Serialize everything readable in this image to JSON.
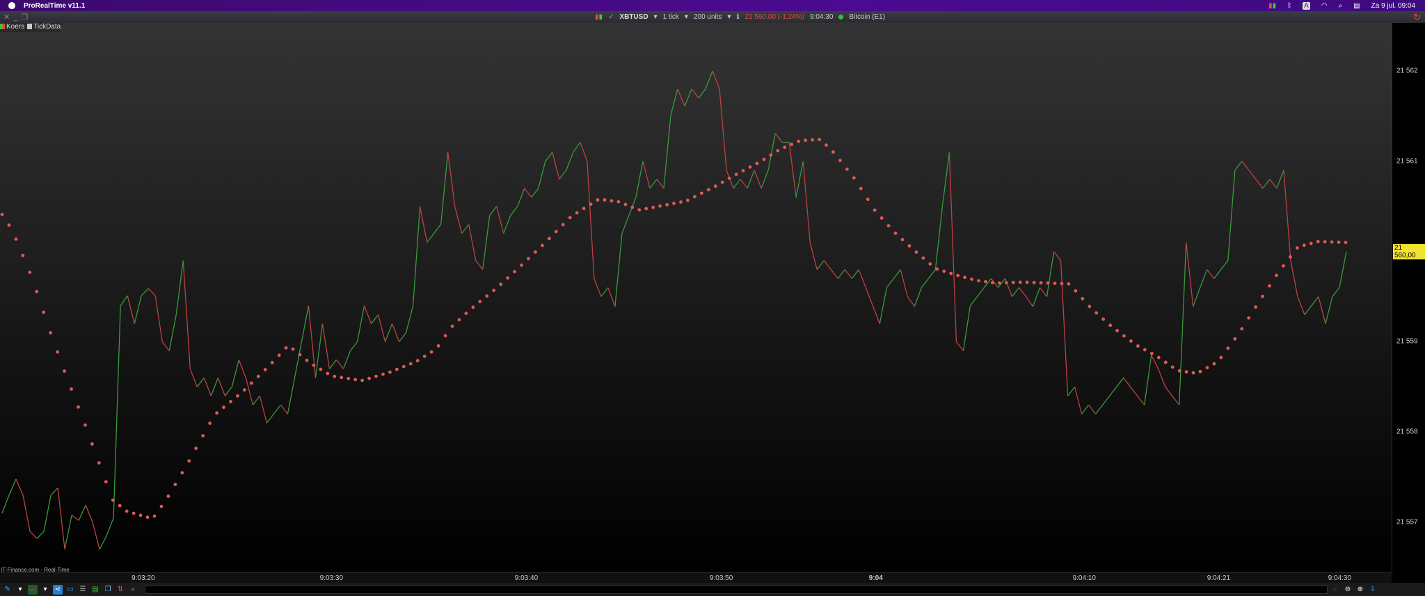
{
  "menubar": {
    "app_name": "ProRealTime v11.1",
    "date_time": "Za 9 jul.  09:04",
    "keyboard": "A"
  },
  "window": {
    "close": "✕",
    "minimize": "_",
    "restore": "❐"
  },
  "symbol_bar": {
    "symbol": "XBTUSD",
    "interval": "1 tick",
    "units": "200 units",
    "price": "21 560,00 (-1,24%)",
    "time": "9:04:30",
    "instrument": "Bitcoin (E1)"
  },
  "legend": {
    "items": [
      {
        "label": "Koers",
        "color": "#e04040"
      },
      {
        "label": "TickData",
        "color": "#cccccc"
      }
    ]
  },
  "source": "IT-Finance.com - Real-Time",
  "colors": {
    "up": "#3a9a3a",
    "down": "#c04040",
    "dots": "#e05a55",
    "current": "#f2e230"
  },
  "chart_data": {
    "type": "line",
    "title": "XBTUSD 1 tick",
    "y_ticks": [
      "21 562",
      "21 561",
      "21 560,00",
      "21 559",
      "21 558",
      "21 557"
    ],
    "y_tick_values": [
      21562,
      21561,
      21560,
      21559,
      21558,
      21557
    ],
    "ylim": [
      21556.5,
      21562.55
    ],
    "current_price": "21 560,00",
    "x_ticks": [
      "9:03:20",
      "9:03:30",
      "9:03:40",
      "9:03:50",
      "9:04",
      "9:04:10",
      "9:04:21",
      "9:04:30"
    ],
    "x_tick_index": [
      21,
      49,
      78,
      107,
      130,
      161,
      181,
      199
    ],
    "x_range": [
      0,
      200
    ],
    "price": [
      21557.1,
      21557.3,
      21557.48,
      21557.3,
      21556.9,
      21556.82,
      21556.9,
      21557.3,
      21557.38,
      21556.7,
      21557.08,
      21557.02,
      21557.19,
      21557.0,
      21556.7,
      21556.85,
      21557.05,
      21559.4,
      21559.51,
      21559.2,
      21559.51,
      21559.59,
      21559.51,
      21559.0,
      21558.9,
      21559.3,
      21559.9,
      21558.7,
      21558.5,
      21558.6,
      21558.4,
      21558.6,
      21558.4,
      21558.5,
      21558.8,
      21558.6,
      21558.3,
      21558.4,
      21558.1,
      21558.2,
      21558.3,
      21558.2,
      21558.6,
      21559.0,
      21559.4,
      21558.6,
      21559.2,
      21558.7,
      21558.8,
      21558.7,
      21558.9,
      21559.0,
      21559.4,
      21559.2,
      21559.3,
      21559.0,
      21559.2,
      21559.0,
      21559.1,
      21559.4,
      21560.5,
      21560.1,
      21560.2,
      21560.3,
      21561.1,
      21560.5,
      21560.2,
      21560.3,
      21559.9,
      21559.8,
      21560.4,
      21560.5,
      21560.2,
      21560.4,
      21560.5,
      21560.7,
      21560.6,
      21560.7,
      21561.0,
      21561.1,
      21560.8,
      21560.9,
      21561.1,
      21561.21,
      21561.0,
      21559.7,
      21559.5,
      21559.6,
      21559.39,
      21560.2,
      21560.4,
      21560.6,
      21561.0,
      21560.7,
      21560.8,
      21560.7,
      21561.51,
      21561.8,
      21561.61,
      21561.8,
      21561.7,
      21561.8,
      21562.0,
      21561.8,
      21560.9,
      21560.7,
      21560.8,
      21560.7,
      21560.9,
      21560.7,
      21560.9,
      21561.31,
      21561.21,
      21561.21,
      21560.6,
      21561.0,
      21560.1,
      21559.8,
      21559.9,
      21559.8,
      21559.7,
      21559.8,
      21559.7,
      21559.8,
      21559.6,
      21559.4,
      21559.2,
      21559.6,
      21559.7,
      21559.8,
      21559.5,
      21559.39,
      21559.6,
      21559.7,
      21559.8,
      21560.5,
      21561.1,
      21559.0,
      21558.9,
      21559.4,
      21559.5,
      21559.6,
      21559.7,
      21559.6,
      21559.7,
      21559.5,
      21559.6,
      21559.5,
      21559.39,
      21559.6,
      21559.5,
      21560.0,
      21559.9,
      21558.4,
      21558.5,
      21558.2,
      21558.3,
      21558.2,
      21558.3,
      21558.4,
      21558.5,
      21558.6,
      21558.5,
      21558.4,
      21558.3,
      21558.85,
      21558.7,
      21558.5,
      21558.4,
      21558.3,
      21560.1,
      21559.39,
      21559.6,
      21559.8,
      21559.7,
      21559.8,
      21559.9,
      21560.9,
      21561.0,
      21560.9,
      21560.8,
      21560.7,
      21560.8,
      21560.7,
      21560.9,
      21559.9,
      21559.5,
      21559.3,
      21559.4,
      21559.5,
      21559.2,
      21559.5,
      21559.6,
      21560.0
    ],
    "moving_average": {
      "dot_count": 195,
      "points": [
        [
          0,
          21560.41
        ],
        [
          1.4,
          21560.25
        ],
        [
          2.4,
          21560.08
        ],
        [
          4.5,
          21559.7
        ],
        [
          7.3,
          21559.08
        ],
        [
          9.3,
          21558.67
        ],
        [
          12.4,
          21558.07
        ],
        [
          15.5,
          21557.44
        ],
        [
          16.4,
          21557.25
        ],
        [
          18.6,
          21557.12
        ],
        [
          22.4,
          21557.04
        ],
        [
          24.5,
          21557.26
        ],
        [
          27.6,
          21557.65
        ],
        [
          31.6,
          21558.19
        ],
        [
          35.7,
          21558.44
        ],
        [
          39.7,
          21558.73
        ],
        [
          42.6,
          21558.96
        ],
        [
          45.9,
          21558.76
        ],
        [
          49.1,
          21558.62
        ],
        [
          53.5,
          21558.57
        ],
        [
          57.6,
          21558.66
        ],
        [
          61.6,
          21558.78
        ],
        [
          64.6,
          21558.92
        ],
        [
          66.8,
          21559.16
        ],
        [
          69.7,
          21559.36
        ],
        [
          73.5,
          21559.59
        ],
        [
          76.6,
          21559.8
        ],
        [
          80.7,
          21560.09
        ],
        [
          84.7,
          21560.39
        ],
        [
          88.8,
          21560.58
        ],
        [
          91.8,
          21560.55
        ],
        [
          94.7,
          21560.46
        ],
        [
          97.7,
          21560.5
        ],
        [
          101.8,
          21560.56
        ],
        [
          105.8,
          21560.71
        ],
        [
          109.6,
          21560.87
        ],
        [
          112.7,
          21560.99
        ],
        [
          115.7,
          21561.13
        ],
        [
          118.8,
          21561.23
        ],
        [
          121.8,
          21561.24
        ],
        [
          123.8,
          21561.09
        ],
        [
          126.8,
          21560.81
        ],
        [
          129.9,
          21560.45
        ],
        [
          132.8,
          21560.21
        ],
        [
          135.9,
          21560.0
        ],
        [
          138.9,
          21559.81
        ],
        [
          141.9,
          21559.74
        ],
        [
          144.9,
          21559.68
        ],
        [
          147.8,
          21559.65
        ],
        [
          151.9,
          21559.66
        ],
        [
          155.8,
          21559.65
        ],
        [
          158.8,
          21559.64
        ],
        [
          161.9,
          21559.38
        ],
        [
          164.9,
          21559.18
        ],
        [
          168.8,
          21558.96
        ],
        [
          171.8,
          21558.84
        ],
        [
          174.9,
          21558.68
        ],
        [
          177.8,
          21558.65
        ],
        [
          180.9,
          21558.78
        ],
        [
          183.9,
          21559.08
        ],
        [
          186.9,
          21559.43
        ],
        [
          189.9,
          21559.77
        ],
        [
          192.8,
          21560.05
        ],
        [
          195.8,
          21560.11
        ],
        [
          199.9,
          21560.1
        ]
      ]
    }
  }
}
